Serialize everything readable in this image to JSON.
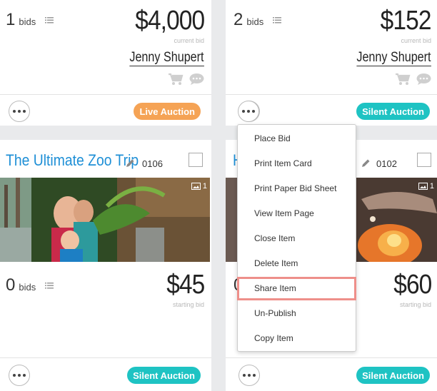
{
  "cards": {
    "top_left": {
      "bid_count": "1",
      "bid_word": "bids",
      "price": "$4,000",
      "price_label": "current bid",
      "bidder": "Jenny Shupert",
      "badge": "Live Auction"
    },
    "top_right": {
      "bid_count": "2",
      "bid_word": "bids",
      "price": "$152",
      "price_label": "current bid",
      "bidder": "Jenny Shupert",
      "badge": "Silent Auction"
    },
    "bottom_left": {
      "title": "The Ultimate Zoo Trip",
      "item_number": "0106",
      "image_count": "1",
      "bid_count": "0",
      "bid_word": "bids",
      "price": "$45",
      "price_label": "starting bid",
      "badge": "Silent Auction"
    },
    "bottom_right": {
      "title": "H",
      "item_number": "0102",
      "image_count": "1",
      "bid_count": "0",
      "price": "$60",
      "price_label": "starting bid",
      "badge": "Silent Auction"
    }
  },
  "menu": {
    "items": [
      "Place Bid",
      "Print Item Card",
      "Print Paper Bid Sheet",
      "View Item Page",
      "Close Item",
      "Delete Item",
      "Share Item",
      "Un-Publish",
      "Copy Item"
    ],
    "highlighted": "Share Item"
  },
  "colors": {
    "live": "#f5a355",
    "silent": "#1ec3c3",
    "title": "#1e8fd6",
    "highlight": "#ee8f8a"
  }
}
